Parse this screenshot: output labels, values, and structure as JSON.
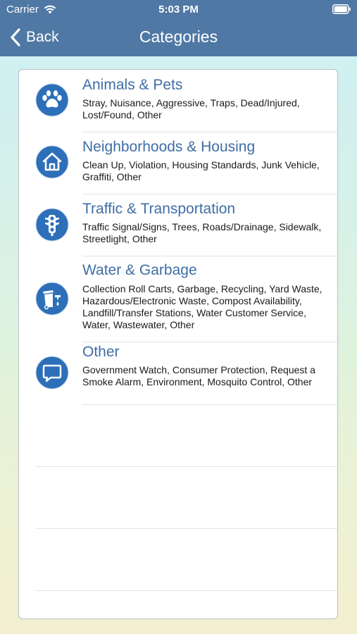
{
  "status_bar": {
    "carrier": "Carrier",
    "time": "5:03 PM",
    "wifi_icon": "wifi-icon",
    "battery_icon": "battery-icon"
  },
  "nav": {
    "back_label": "Back",
    "back_icon": "chevron-left-icon",
    "title": "Categories"
  },
  "colors": {
    "navbar": "#4f78a5",
    "title_blue": "#3f6ea6",
    "icon_blue": "#2d6fb8"
  },
  "categories": [
    {
      "title": "Animals & Pets",
      "icon": "paw-icon",
      "description": "Stray, Nuisance, Aggressive, Traps, Dead/Injured, Lost/Found, Other"
    },
    {
      "title": "Neighborhoods & Housing",
      "icon": "house-icon",
      "description": "Clean Up, Violation, Housing Standards, Junk Vehicle, Graffiti, Other"
    },
    {
      "title": "Traffic & Transportation",
      "icon": "traffic-light-icon",
      "description": "Traffic Signal/Signs, Trees, Roads/Drainage, Sidewalk, Streetlight, Other"
    },
    {
      "title": "Water & Garbage",
      "icon": "trash-water-icon",
      "description": "Collection Roll Carts, Garbage, Recycling, Yard Waste, Hazardous/Electronic Waste, Compost Availability, Landfill/Transfer Stations, Water Customer Service, Water, Wastewater, Other"
    },
    {
      "title": "Other",
      "icon": "speech-bubble-icon",
      "description": "Government Watch, Consumer Protection, Request a Smoke Alarm, Environment, Mosquito Control, Other"
    }
  ]
}
